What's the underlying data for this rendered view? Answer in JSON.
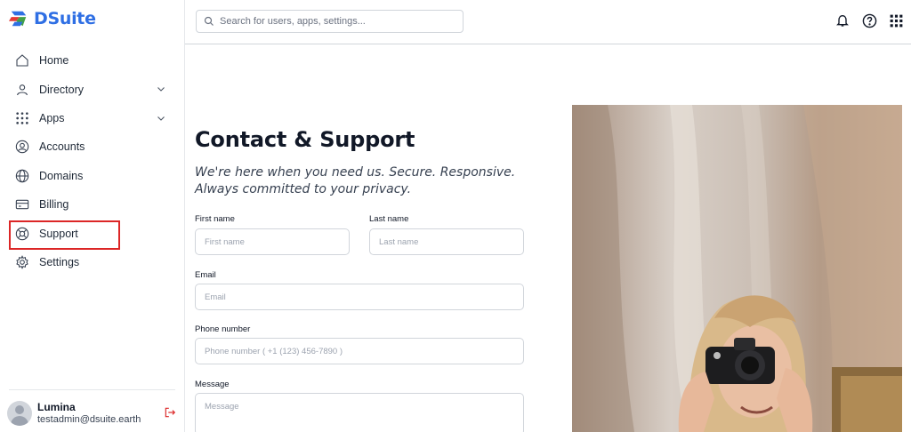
{
  "brand": {
    "name": "DSuite"
  },
  "sidebar": {
    "items": [
      {
        "label": "Home",
        "icon": "home-icon"
      },
      {
        "label": "Directory",
        "icon": "user-icon",
        "expandable": true
      },
      {
        "label": "Apps",
        "icon": "grid-icon",
        "expandable": true
      },
      {
        "label": "Accounts",
        "icon": "account-circle-icon"
      },
      {
        "label": "Domains",
        "icon": "globe-icon"
      },
      {
        "label": "Billing",
        "icon": "billing-icon"
      },
      {
        "label": "Support",
        "icon": "lifebuoy-icon",
        "highlighted": true
      },
      {
        "label": "Settings",
        "icon": "gear-icon"
      }
    ]
  },
  "user": {
    "name": "Lumina",
    "email": "testadmin@dsuite.earth"
  },
  "search": {
    "placeholder": "Search for users, apps, settings..."
  },
  "topbar": {
    "icons": [
      "bell-icon",
      "help-icon",
      "apps-grid-icon"
    ]
  },
  "page": {
    "title": "Contact & Support",
    "subtitle": "We're here when you need us. Secure. Responsive. Always committed to your privacy."
  },
  "form": {
    "first_name": {
      "label": "First name",
      "placeholder": "First name"
    },
    "last_name": {
      "label": "Last name",
      "placeholder": "Last name"
    },
    "email": {
      "label": "Email",
      "placeholder": "Email"
    },
    "phone": {
      "label": "Phone number",
      "placeholder": "Phone number ( +1 (123) 456-7890 )"
    },
    "message": {
      "label": "Message",
      "placeholder": "Message"
    }
  },
  "colors": {
    "brand": "#2f6fe4",
    "highlight": "#dc2626",
    "logout": "#dc2626"
  }
}
